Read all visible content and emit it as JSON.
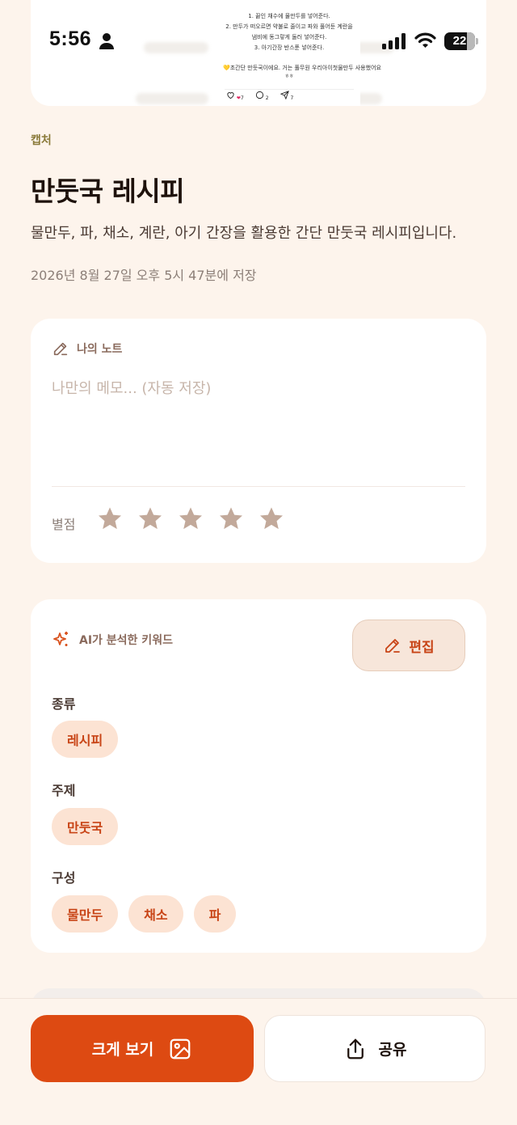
{
  "status_bar": {
    "time": "5:56",
    "battery": "22"
  },
  "capture_preview": {
    "lines": [
      "1. 끓인 채수에 물만두를 넣어준다.",
      "2. 만두가 떠오르면 약불로 줄이고 파와 풀어둔 계란을",
      "냄비에 동그랗게 둘러 넣어준다.",
      "3. 아기간장 반스푼 넣어준다."
    ],
    "caption": "💛초간단 만둣국이에요. 거는 풀무원 우리아이첫물만두 사용했어요",
    "caption_tail": "ㅎㅎ",
    "likes": "7",
    "comments": "2",
    "shares": "7"
  },
  "header": {
    "category": "캡처",
    "title": "만둣국 레시피",
    "description": "물만두, 파, 채소, 계란, 아기 간장을 활용한 간단 만둣국 레시피입니다.",
    "saved_at": "2026년 8월 27일 오후 5시 47분에 저장"
  },
  "note": {
    "heading": "나의 노트",
    "placeholder": "나만의 메모... (자동 저장)",
    "value": "",
    "rating_label": "별점",
    "rating": 0,
    "max_rating": 5,
    "star_color": "#C2A99A"
  },
  "keywords": {
    "heading": "AI가 분석한 키워드",
    "edit_label": "편집",
    "sections": [
      {
        "label": "종류",
        "chips": [
          "레시피"
        ]
      },
      {
        "label": "주제",
        "chips": [
          "만둣국"
        ]
      },
      {
        "label": "구성",
        "chips": [
          "물만두",
          "채소",
          "파"
        ]
      }
    ]
  },
  "actions": {
    "view_label": "크게 보기",
    "share_label": "공유"
  },
  "colors": {
    "accent": "#DD4A12",
    "background": "#FDF4EC",
    "chip_bg": "#FCE3D3"
  }
}
